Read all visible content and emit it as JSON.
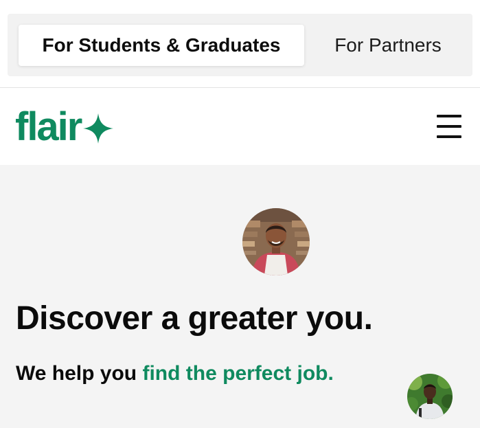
{
  "tabs": {
    "students_label": "For Students & Graduates",
    "partners_label": "For Partners"
  },
  "header": {
    "logo_text": "flair",
    "logo_icon": "sparkle-star-icon",
    "menu_icon": "hamburger-menu-icon"
  },
  "hero": {
    "headline": "Discover a greater you.",
    "subline_prefix": "We help you ",
    "subline_accent": "find the perfect job."
  },
  "colors": {
    "brand_green": "#0f8a5f",
    "hero_background": "#f4f4f4",
    "tabs_background": "#f2f2f2"
  }
}
